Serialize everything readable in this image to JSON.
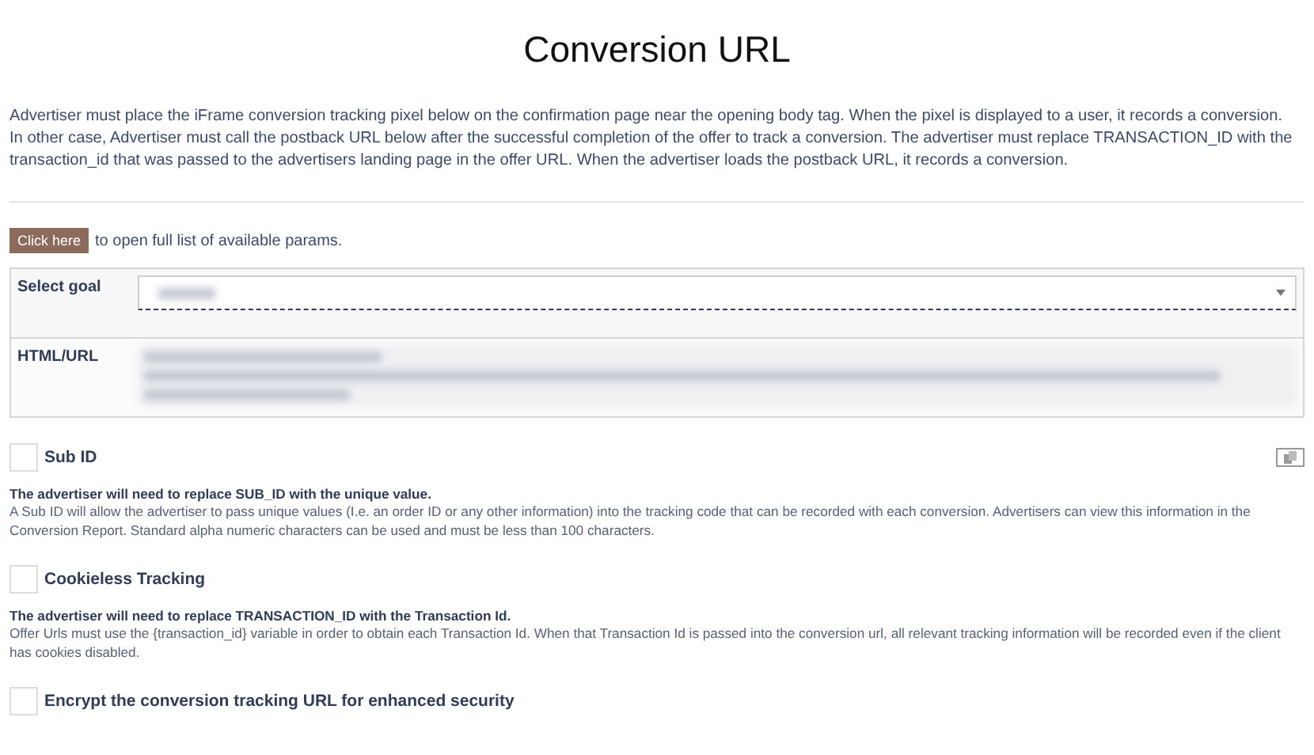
{
  "title": "Conversion URL",
  "intro": [
    "Advertiser must place the iFrame conversion tracking pixel below on the confirmation page near the opening body tag. When the pixel is displayed to a user, it records a conversion.",
    "In other case, Advertiser must call the postback URL below after the successful completion of the offer to track a conversion. The advertiser must replace TRANSACTION_ID with the transaction_id that was passed to the advertisers landing page in the offer URL. When the advertiser loads the postback URL, it records a conversion."
  ],
  "params": {
    "button": "Click here",
    "text": "to open full list of available params."
  },
  "form": {
    "goal_label": "Select goal",
    "html_label": "HTML/URL"
  },
  "options": [
    {
      "label": "Sub ID",
      "checked": false,
      "copy": true,
      "note": "The advertiser will need to replace SUB_ID with the unique value.",
      "description": "A Sub ID will allow the advertiser to pass unique values (I.e. an order ID or any other information) into the tracking code that can be recorded with each conversion. Advertisers can view this information in the Conversion Report. Standard alpha numeric characters can be used and must be less than 100 characters."
    },
    {
      "label": "Cookieless Tracking",
      "checked": false,
      "copy": false,
      "note": "The advertiser will need to replace TRANSACTION_ID with the Transaction Id.",
      "description": "Offer Urls must use the {transaction_id} variable in order to obtain each Transaction Id. When that Transaction Id is passed into the conversion url, all relevant tracking information will be recorded even if the client has cookies disabled."
    },
    {
      "label": "Encrypt the conversion tracking URL for enhanced security",
      "checked": false,
      "copy": false
    }
  ]
}
